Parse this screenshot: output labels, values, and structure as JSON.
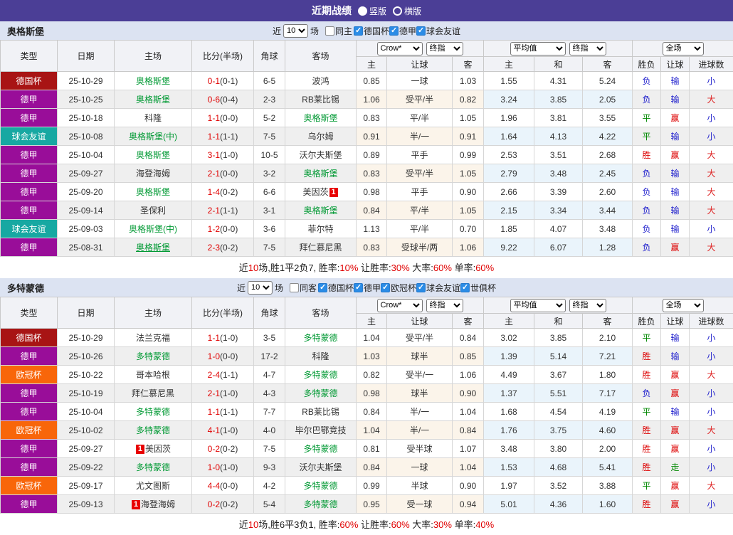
{
  "topbar": {
    "title": "近期战绩",
    "options": [
      {
        "label": "竖版",
        "selected": true
      },
      {
        "label": "横版",
        "selected": false
      }
    ]
  },
  "common": {
    "near_label": "近",
    "count": "10",
    "field_label": "场",
    "left_headers": [
      "类型",
      "日期",
      "主场",
      "比分(半场)",
      "角球",
      "客场"
    ],
    "sub_headers": [
      "主",
      "让球",
      "客",
      "主",
      "和",
      "客",
      "胜负",
      "让球",
      "进球数"
    ],
    "dropdowns": {
      "book": "Crow*",
      "final1": "终指",
      "avg": "平均值",
      "final2": "终指",
      "scope": "全场"
    },
    "colors": {
      "league": {
        "德国杯": "#a81414",
        "德甲": "#990d99",
        "球会友谊": "#17a8a2",
        "欧冠杯": "#f8660a"
      },
      "result": {
        "胜": "#dd0000",
        "平": "#008800",
        "负": "#1a1acc",
        "赢": "#dd0000",
        "走": "#008800",
        "输": "#1a1acc",
        "大": "#dd2222",
        "小": "#2222cc"
      }
    }
  },
  "sections": [
    {
      "team": "奥格斯堡",
      "filters": {
        "same": {
          "label": "同主",
          "checked": false
        },
        "leagues": [
          {
            "label": "德国杯",
            "checked": true
          },
          {
            "label": "德甲",
            "checked": true
          },
          {
            "label": "球会友谊",
            "checked": true
          }
        ]
      },
      "rows": [
        {
          "league": "德国杯",
          "date": "25-10-29",
          "home": {
            "name": "奥格斯堡",
            "green": true
          },
          "score": "0-1",
          "half": "(0-1)",
          "corner": "6-5",
          "away": {
            "name": "波鸿"
          },
          "crow": [
            "0.85",
            "一球",
            "1.03"
          ],
          "avg": [
            "1.55",
            "4.31",
            "5.24"
          ],
          "result": [
            "负",
            "输",
            "小"
          ]
        },
        {
          "league": "德甲",
          "date": "25-10-25",
          "home": {
            "name": "奥格斯堡",
            "green": true
          },
          "score": "0-6",
          "half": "(0-4)",
          "corner": "2-3",
          "away": {
            "name": "RB莱比锡"
          },
          "crow": [
            "1.06",
            "受平/半",
            "0.82"
          ],
          "avg": [
            "3.24",
            "3.85",
            "2.05"
          ],
          "result": [
            "负",
            "输",
            "大"
          ]
        },
        {
          "league": "德甲",
          "date": "25-10-18",
          "home": {
            "name": "科隆"
          },
          "score": "1-1",
          "half": "(0-0)",
          "corner": "5-2",
          "away": {
            "name": "奥格斯堡",
            "green": true
          },
          "crow": [
            "0.83",
            "平/半",
            "1.05"
          ],
          "avg": [
            "1.96",
            "3.81",
            "3.55"
          ],
          "result": [
            "平",
            "赢",
            "小"
          ]
        },
        {
          "league": "球会友谊",
          "date": "25-10-08",
          "home": {
            "name": "奥格斯堡(中)",
            "green": true
          },
          "score": "1-1",
          "half": "(1-1)",
          "corner": "7-5",
          "away": {
            "name": "乌尔姆"
          },
          "crow": [
            "0.91",
            "半/一",
            "0.91"
          ],
          "avg": [
            "1.64",
            "4.13",
            "4.22"
          ],
          "result": [
            "平",
            "输",
            "小"
          ]
        },
        {
          "league": "德甲",
          "date": "25-10-04",
          "home": {
            "name": "奥格斯堡",
            "green": true
          },
          "score": "3-1",
          "half": "(1-0)",
          "corner": "10-5",
          "away": {
            "name": "沃尔夫斯堡"
          },
          "crow": [
            "0.89",
            "平手",
            "0.99"
          ],
          "avg": [
            "2.53",
            "3.51",
            "2.68"
          ],
          "result": [
            "胜",
            "赢",
            "大"
          ]
        },
        {
          "league": "德甲",
          "date": "25-09-27",
          "home": {
            "name": "海登海姆"
          },
          "score": "2-1",
          "half": "(0-0)",
          "corner": "3-2",
          "away": {
            "name": "奥格斯堡",
            "green": true
          },
          "crow": [
            "0.83",
            "受平/半",
            "1.05"
          ],
          "avg": [
            "2.79",
            "3.48",
            "2.45"
          ],
          "result": [
            "负",
            "输",
            "大"
          ]
        },
        {
          "league": "德甲",
          "date": "25-09-20",
          "home": {
            "name": "奥格斯堡",
            "green": true
          },
          "score": "1-4",
          "half": "(0-2)",
          "corner": "6-6",
          "away": {
            "name": "美因茨",
            "badge_after": "1"
          },
          "crow": [
            "0.98",
            "平手",
            "0.90"
          ],
          "avg": [
            "2.66",
            "3.39",
            "2.60"
          ],
          "result": [
            "负",
            "输",
            "大"
          ]
        },
        {
          "league": "德甲",
          "date": "25-09-14",
          "home": {
            "name": "圣保利"
          },
          "score": "2-1",
          "half": "(1-1)",
          "corner": "3-1",
          "away": {
            "name": "奥格斯堡",
            "green": true
          },
          "crow": [
            "0.84",
            "平/半",
            "1.05"
          ],
          "avg": [
            "2.15",
            "3.34",
            "3.44"
          ],
          "result": [
            "负",
            "输",
            "大"
          ]
        },
        {
          "league": "球会友谊",
          "date": "25-09-03",
          "home": {
            "name": "奥格斯堡(中)",
            "green": true
          },
          "score": "1-2",
          "half": "(0-0)",
          "corner": "3-6",
          "away": {
            "name": "菲尔特"
          },
          "crow": [
            "1.13",
            "平/半",
            "0.70"
          ],
          "avg": [
            "1.85",
            "4.07",
            "3.48"
          ],
          "result": [
            "负",
            "输",
            "小"
          ]
        },
        {
          "league": "德甲",
          "date": "25-08-31",
          "home": {
            "name": "奥格斯堡",
            "green": true,
            "underline": true
          },
          "score": "2-3",
          "half": "(0-2)",
          "corner": "7-5",
          "away": {
            "name": "拜仁慕尼黑"
          },
          "crow": [
            "0.83",
            "受球半/两",
            "1.06"
          ],
          "avg": [
            "9.22",
            "6.07",
            "1.28"
          ],
          "result": [
            "负",
            "赢",
            "大"
          ]
        }
      ],
      "summary": [
        [
          "近",
          0
        ],
        [
          "10",
          1
        ],
        [
          "场,胜1平2负7, 胜率:",
          0
        ],
        [
          "10%",
          1
        ],
        [
          " 让胜率:",
          0
        ],
        [
          "30%",
          1
        ],
        [
          " 大率:",
          0
        ],
        [
          "60%",
          1
        ],
        [
          " 单率:",
          0
        ],
        [
          "60%",
          1
        ]
      ]
    },
    {
      "team": "多特蒙德",
      "filters": {
        "same": {
          "label": "同客",
          "checked": false
        },
        "leagues": [
          {
            "label": "德国杯",
            "checked": true
          },
          {
            "label": "德甲",
            "checked": true
          },
          {
            "label": "欧冠杯",
            "checked": true
          },
          {
            "label": "球会友谊",
            "checked": true
          },
          {
            "label": "世俱杯",
            "checked": true
          }
        ]
      },
      "rows": [
        {
          "league": "德国杯",
          "date": "25-10-29",
          "home": {
            "name": "法兰克福"
          },
          "score": "1-1",
          "half": "(1-0)",
          "corner": "3-5",
          "away": {
            "name": "多特蒙德",
            "green": true
          },
          "crow": [
            "1.04",
            "受平/半",
            "0.84"
          ],
          "avg": [
            "3.02",
            "3.85",
            "2.10"
          ],
          "result": [
            "平",
            "输",
            "小"
          ]
        },
        {
          "league": "德甲",
          "date": "25-10-26",
          "home": {
            "name": "多特蒙德",
            "green": true
          },
          "score": "1-0",
          "half": "(0-0)",
          "corner": "17-2",
          "away": {
            "name": "科隆"
          },
          "crow": [
            "1.03",
            "球半",
            "0.85"
          ],
          "avg": [
            "1.39",
            "5.14",
            "7.21"
          ],
          "result": [
            "胜",
            "输",
            "小"
          ]
        },
        {
          "league": "欧冠杯",
          "date": "25-10-22",
          "home": {
            "name": "哥本哈根"
          },
          "score": "2-4",
          "half": "(1-1)",
          "corner": "4-7",
          "away": {
            "name": "多特蒙德",
            "green": true
          },
          "crow": [
            "0.82",
            "受半/一",
            "1.06"
          ],
          "avg": [
            "4.49",
            "3.67",
            "1.80"
          ],
          "result": [
            "胜",
            "赢",
            "大"
          ]
        },
        {
          "league": "德甲",
          "date": "25-10-19",
          "home": {
            "name": "拜仁慕尼黑"
          },
          "score": "2-1",
          "half": "(1-0)",
          "corner": "4-3",
          "away": {
            "name": "多特蒙德",
            "green": true
          },
          "crow": [
            "0.98",
            "球半",
            "0.90"
          ],
          "avg": [
            "1.37",
            "5.51",
            "7.17"
          ],
          "result": [
            "负",
            "赢",
            "小"
          ]
        },
        {
          "league": "德甲",
          "date": "25-10-04",
          "home": {
            "name": "多特蒙德",
            "green": true
          },
          "score": "1-1",
          "half": "(1-1)",
          "corner": "7-7",
          "away": {
            "name": "RB莱比锡"
          },
          "crow": [
            "0.84",
            "半/一",
            "1.04"
          ],
          "avg": [
            "1.68",
            "4.54",
            "4.19"
          ],
          "result": [
            "平",
            "输",
            "小"
          ]
        },
        {
          "league": "欧冠杯",
          "date": "25-10-02",
          "home": {
            "name": "多特蒙德",
            "green": true
          },
          "score": "4-1",
          "half": "(1-0)",
          "corner": "4-0",
          "away": {
            "name": "毕尔巴鄂竞技"
          },
          "crow": [
            "1.04",
            "半/一",
            "0.84"
          ],
          "avg": [
            "1.76",
            "3.75",
            "4.60"
          ],
          "result": [
            "胜",
            "赢",
            "大"
          ]
        },
        {
          "league": "德甲",
          "date": "25-09-27",
          "home": {
            "name": "美因茨",
            "badge_before": "1"
          },
          "score": "0-2",
          "half": "(0-2)",
          "corner": "7-5",
          "away": {
            "name": "多特蒙德",
            "green": true
          },
          "crow": [
            "0.81",
            "受半球",
            "1.07"
          ],
          "avg": [
            "3.48",
            "3.80",
            "2.00"
          ],
          "result": [
            "胜",
            "赢",
            "小"
          ]
        },
        {
          "league": "德甲",
          "date": "25-09-22",
          "home": {
            "name": "多特蒙德",
            "green": true
          },
          "score": "1-0",
          "half": "(1-0)",
          "corner": "9-3",
          "away": {
            "name": "沃尔夫斯堡"
          },
          "crow": [
            "0.84",
            "一球",
            "1.04"
          ],
          "avg": [
            "1.53",
            "4.68",
            "5.41"
          ],
          "result": [
            "胜",
            "走",
            "小"
          ]
        },
        {
          "league": "欧冠杯",
          "date": "25-09-17",
          "home": {
            "name": "尤文图斯"
          },
          "score": "4-4",
          "half": "(0-0)",
          "corner": "4-2",
          "away": {
            "name": "多特蒙德",
            "green": true
          },
          "crow": [
            "0.99",
            "半球",
            "0.90"
          ],
          "avg": [
            "1.97",
            "3.52",
            "3.88"
          ],
          "result": [
            "平",
            "赢",
            "大"
          ]
        },
        {
          "league": "德甲",
          "date": "25-09-13",
          "home": {
            "name": "海登海姆",
            "badge_before": "1"
          },
          "score": "0-2",
          "half": "(0-2)",
          "corner": "5-4",
          "away": {
            "name": "多特蒙德",
            "green": true
          },
          "crow": [
            "0.95",
            "受一球",
            "0.94"
          ],
          "avg": [
            "5.01",
            "4.36",
            "1.60"
          ],
          "result": [
            "胜",
            "赢",
            "小"
          ]
        }
      ],
      "summary": [
        [
          "近",
          0
        ],
        [
          "10",
          1
        ],
        [
          "场,胜6平3负1, 胜率:",
          0
        ],
        [
          "60%",
          1
        ],
        [
          " 让胜率:",
          0
        ],
        [
          "60%",
          1
        ],
        [
          " 大率:",
          0
        ],
        [
          "30%",
          1
        ],
        [
          " 单率:",
          0
        ],
        [
          "40%",
          1
        ]
      ]
    }
  ]
}
